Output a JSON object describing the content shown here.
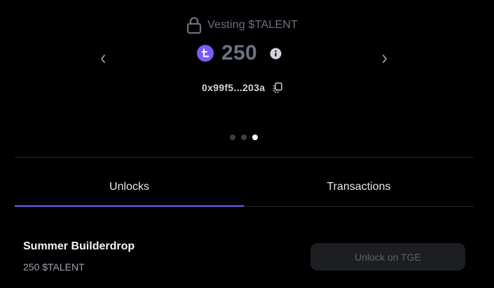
{
  "vesting": {
    "title": "Vesting $TALENT",
    "lock_icon": "lock-icon",
    "token_icon": "talent-token-icon",
    "amount": "250",
    "info_icon": "info-icon",
    "address": "0x99f5...203a",
    "copy_icon": "copy-icon",
    "prev_icon": "chevron-left-icon",
    "next_icon": "chevron-right-icon"
  },
  "carousel": {
    "dots": 3,
    "active_index": 2
  },
  "tabs": [
    {
      "label": "Unlocks",
      "active": true
    },
    {
      "label": "Transactions",
      "active": false
    }
  ],
  "unlocks": [
    {
      "name": "Summer Builderdrop",
      "amount": "250 $TALENT",
      "button_label": "Unlock on TGE",
      "button_disabled": true
    }
  ],
  "colors": {
    "background": "#000000",
    "accent": "#7b5cf5",
    "muted_text": "#6b7280",
    "divider": "#23262c"
  }
}
